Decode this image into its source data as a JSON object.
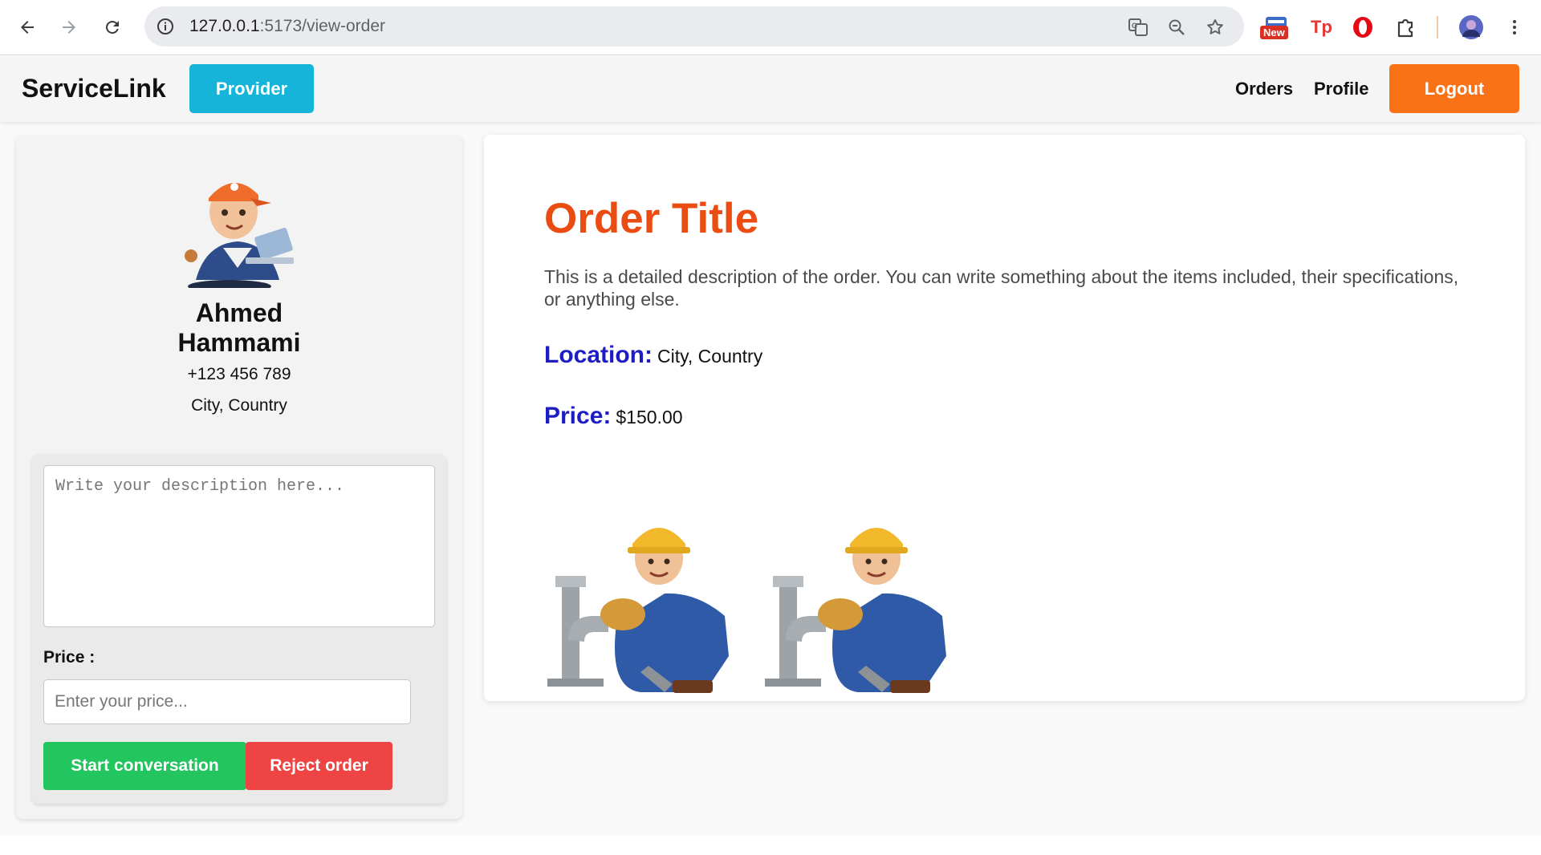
{
  "browser": {
    "url_host": "127.0.0.1",
    "url_path": ":5173/view-order",
    "ext_badge": "New"
  },
  "navbar": {
    "brand": "ServiceLink",
    "role_button": "Provider",
    "links": [
      "Orders",
      "Profile"
    ],
    "logout": "Logout"
  },
  "provider": {
    "first_name": "Ahmed",
    "last_name": "Hammami",
    "phone": "+123 456 789",
    "location": "City, Country"
  },
  "proposal_form": {
    "description_placeholder": "Write your description here...",
    "price_label": "Price :",
    "price_placeholder": "Enter your price...",
    "start_button": "Start conversation",
    "reject_button": "Reject order"
  },
  "order": {
    "title": "Order Title",
    "description": "This is a detailed description of the order. You can write something about the items included, their specifications, or anything else.",
    "location_label": "Location:",
    "location_value": "City, Country",
    "price_label": "Price:",
    "price_value": "$150.00"
  },
  "colors": {
    "provider_button": "#16b4d8",
    "logout_button": "#f97316",
    "title": "#ea4c12",
    "field_label": "#1d1dc6",
    "start_button": "#22c55e",
    "reject_button": "#ef4444"
  }
}
